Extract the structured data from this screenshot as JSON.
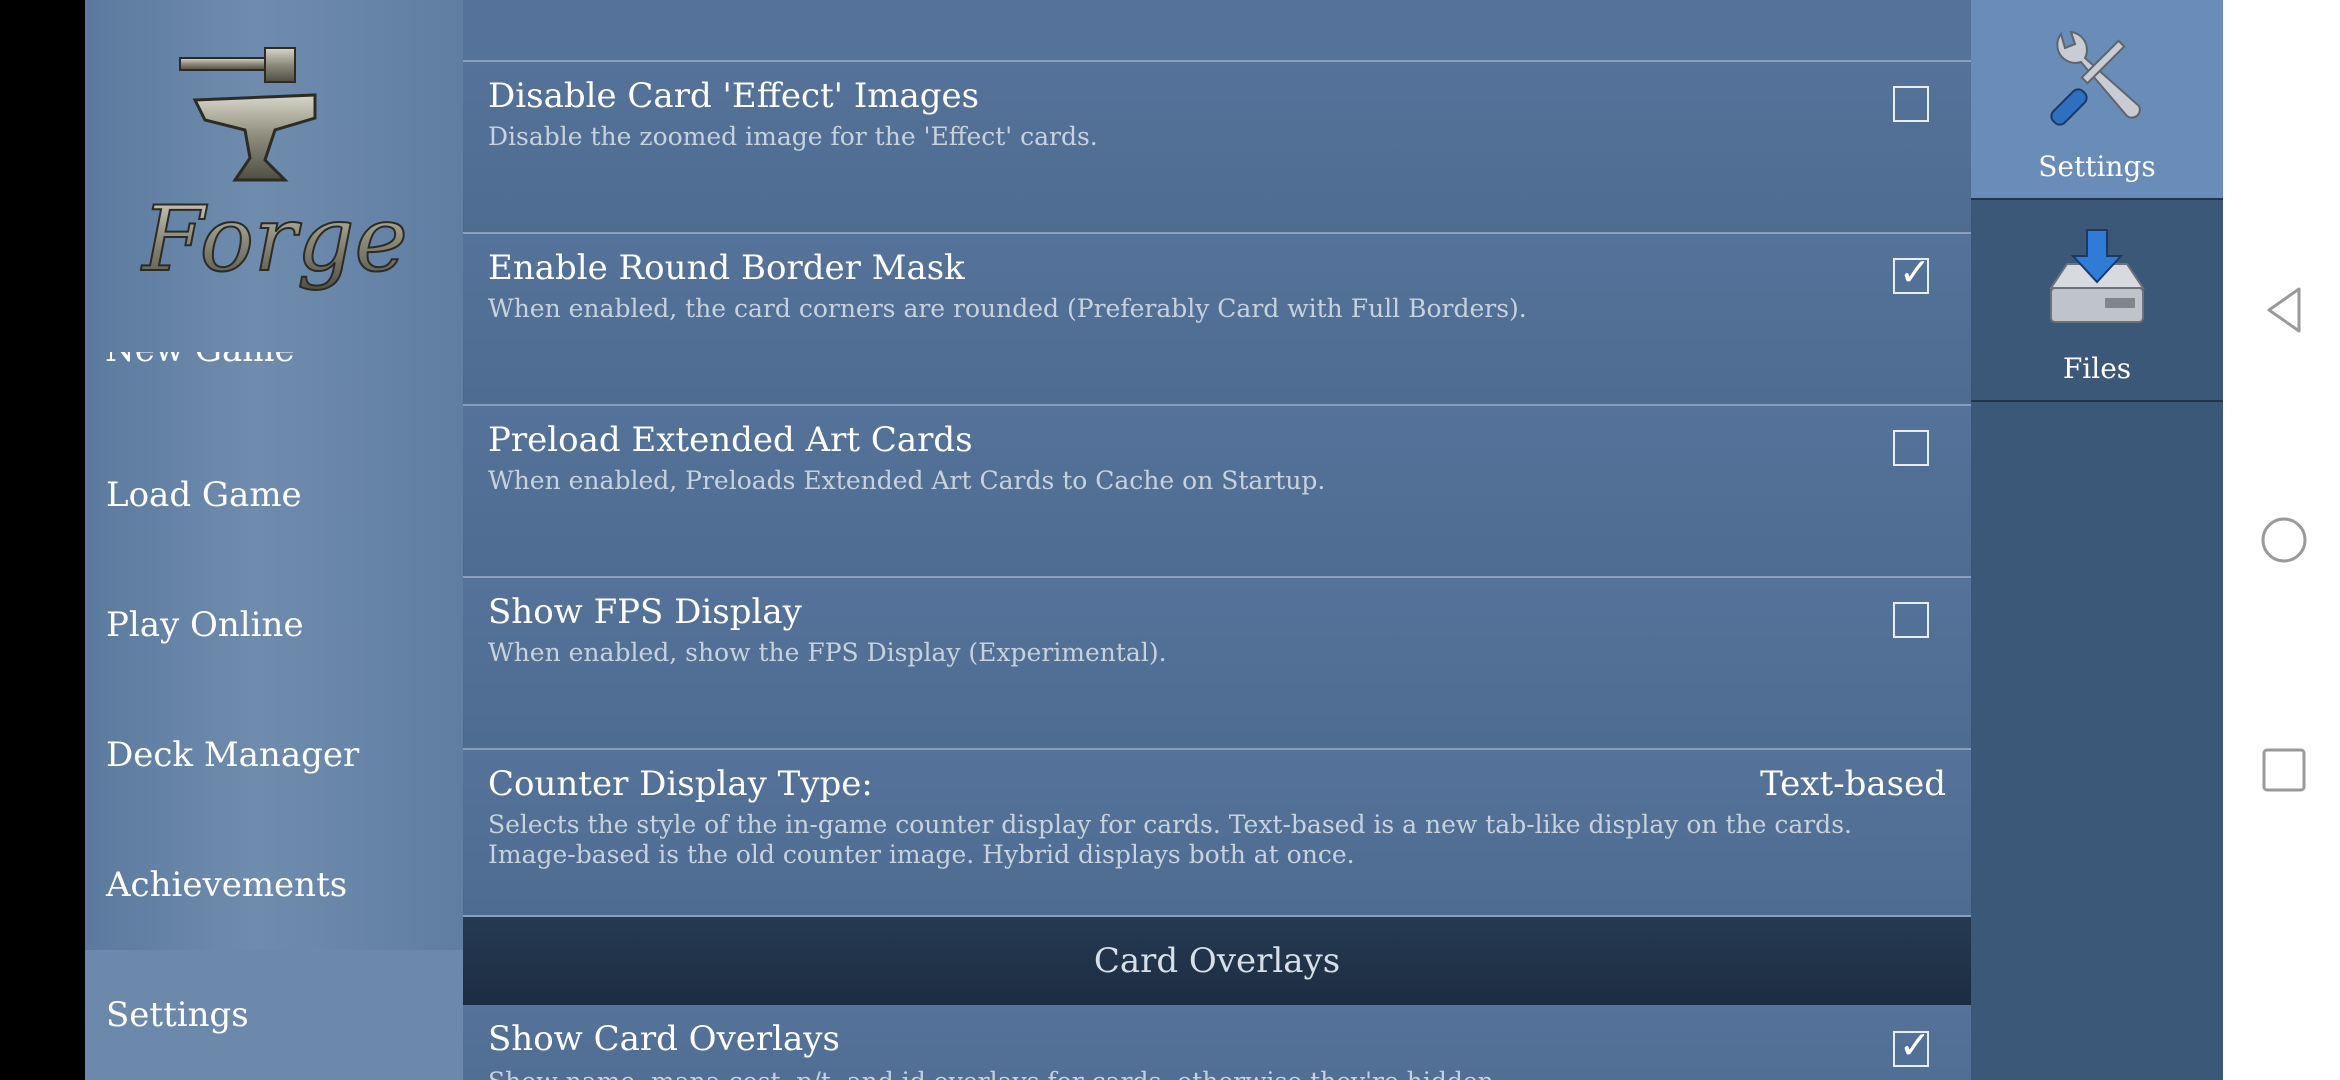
{
  "nav": {
    "logo_text": "Forge",
    "cut_item": "New Game",
    "items": [
      "Load Game",
      "Play Online",
      "Deck Manager",
      "Achievements",
      "Settings"
    ],
    "selected": "Settings"
  },
  "settings": [
    {
      "title": "Disable Card 'Effect' Images",
      "desc": "Disable the zoomed image for the 'Effect' cards.",
      "checked": false
    },
    {
      "title": "Enable Round Border Mask",
      "desc": "When enabled, the card corners are rounded (Preferably Card with Full Borders).",
      "checked": true
    },
    {
      "title": "Preload Extended Art Cards",
      "desc": "When enabled, Preloads Extended Art Cards to Cache on Startup.",
      "checked": false
    },
    {
      "title": "Show FPS Display",
      "desc": "When enabled, show the FPS Display (Experimental).",
      "checked": false
    },
    {
      "title": "Counter Display Type:",
      "value": "Text-based",
      "desc": "Selects the style of the in-game counter display for cards. Text-based is a new tab-like display on the cards. Image-based is the old counter image. Hybrid displays both at once."
    }
  ],
  "section": {
    "title": "Card Overlays"
  },
  "last_row": {
    "title": "Show Card Overlays",
    "desc": "Show name, mana cost, p/t, and id overlays for cards, otherwise they're hidden.",
    "checked": true
  },
  "tick_glyph": "✓",
  "right_tabs": [
    {
      "label": "Settings",
      "icon": "wrench-screwdriver-icon",
      "selected": true
    },
    {
      "label": "Files",
      "icon": "download-drive-icon",
      "selected": false
    }
  ],
  "colors": {
    "nav_bg": "#6f8cae",
    "main_bg": "#4f6b8c",
    "section_header_bg": "#1c2d42",
    "right_panel_bg": "#3c5878",
    "right_tab_selected": "#6a8cb8"
  }
}
